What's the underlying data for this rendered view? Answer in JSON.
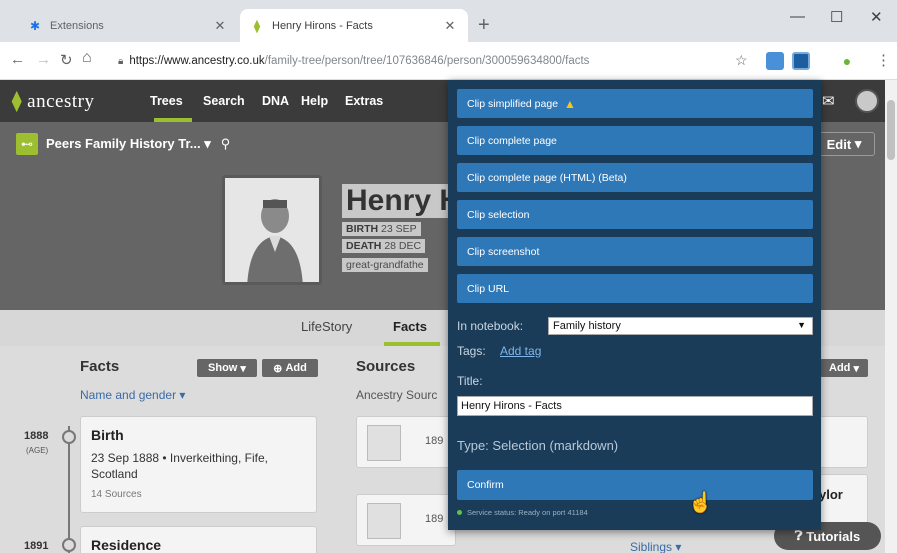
{
  "browser": {
    "tabs": [
      {
        "label": "Extensions",
        "icon": "puzzle-icon"
      },
      {
        "label": "Henry Hirons - Facts",
        "icon": "ancestry-leaf-icon"
      }
    ],
    "url_host": "https://www.ancestry.co.uk",
    "url_path": "/family-tree/person/tree/107636846/person/300059634800/facts"
  },
  "site": {
    "logo": "ancestry",
    "nav": [
      "Trees",
      "Search",
      "DNA",
      "Help",
      "Extras"
    ],
    "tree_name": "Peers Family History Tr...",
    "edit_label": "Edit",
    "person": {
      "name": "Henry H",
      "birth_label": "BIRTH",
      "birth_value": "23 SEP",
      "death_label": "DEATH",
      "death_value": "28 DEC",
      "relation": "great-grandfathe"
    },
    "subnav": [
      "LifeStory",
      "Facts"
    ],
    "facts": {
      "title": "Facts",
      "show_label": "Show",
      "add_label": "Add",
      "filter": "Name and gender",
      "items": [
        {
          "year": "1888",
          "age": "(AGE)",
          "title": "Birth",
          "detail": "23 Sep 1888 • Inverkeithing, Fife, Scotland",
          "sources": "14 Sources"
        },
        {
          "year": "1891",
          "age": "",
          "title": "Residence",
          "detail": "",
          "sources": ""
        }
      ]
    },
    "sources": {
      "title": "Sources",
      "subtitle": "Ancestry Sourc",
      "items": [
        "189",
        "189"
      ]
    },
    "right": {
      "add_label": "Add",
      "name_fragment": "ylor",
      "siblings": "Siblings",
      "tutorials": "Tutorials"
    }
  },
  "clipper": {
    "buttons": [
      "Clip simplified page",
      "Clip complete page",
      "Clip complete page (HTML) (Beta)",
      "Clip selection",
      "Clip screenshot",
      "Clip URL"
    ],
    "notebook_label": "In notebook:",
    "notebook_value": "Family history",
    "tags_label": "Tags:",
    "add_tag": "Add tag",
    "title_label": "Title:",
    "title_value": "Henry Hirons - Facts",
    "type_label": "Type: Selection (markdown)",
    "confirm": "Confirm",
    "service_status": "Service status: Ready on port 41184"
  }
}
